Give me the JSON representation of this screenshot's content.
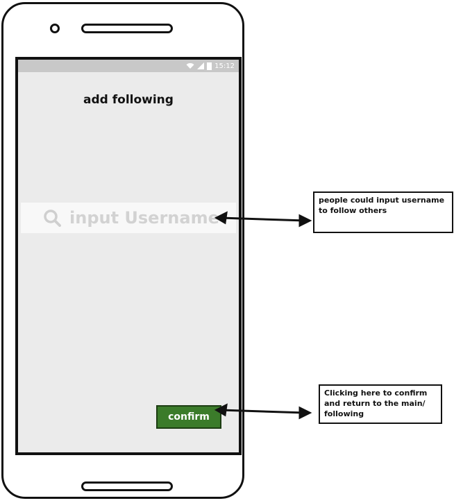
{
  "status_bar": {
    "time": "15:12"
  },
  "screen": {
    "title": "add following"
  },
  "search": {
    "placeholder": "input Username",
    "icon": "search-icon"
  },
  "confirm_button": {
    "label": "confirm"
  },
  "annotations": {
    "username_note": "people could input username to follow others",
    "confirm_note": "Clicking here to confirm and return to the main/ following"
  },
  "colors": {
    "screen_background": "#ebebeb",
    "status_bar": "#c8c8c8",
    "confirm_button": "#3b7b2a",
    "placeholder_text": "#d2d2d2"
  }
}
